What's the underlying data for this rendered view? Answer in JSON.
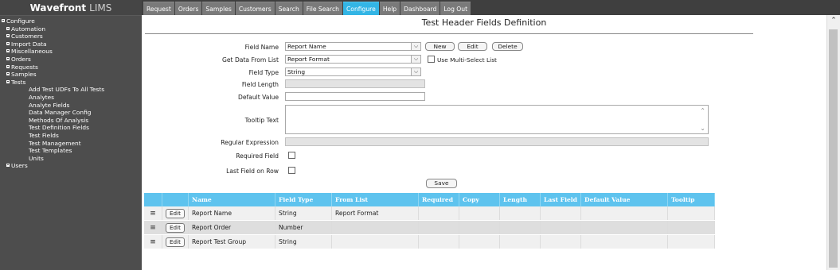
{
  "app": {
    "brand_name": "Wavefront",
    "brand_suffix": "LIMS"
  },
  "nav": {
    "tabs": [
      {
        "label": "Request"
      },
      {
        "label": "Orders"
      },
      {
        "label": "Samples"
      },
      {
        "label": "Customers"
      },
      {
        "label": "Search"
      },
      {
        "label": "File Search"
      },
      {
        "label": "Configure",
        "active": true
      },
      {
        "label": "Help"
      },
      {
        "label": "Dashboard"
      },
      {
        "label": "Log Out"
      }
    ]
  },
  "sidebar": {
    "root": "Configure",
    "items": [
      {
        "label": "Automation"
      },
      {
        "label": "Customers"
      },
      {
        "label": "Import Data"
      },
      {
        "label": "Miscellaneous"
      },
      {
        "label": "Orders"
      },
      {
        "label": "Requests"
      },
      {
        "label": "Samples"
      },
      {
        "label": "Tests"
      }
    ],
    "tests_children": [
      {
        "label": "Add Test UDFs To All Tests"
      },
      {
        "label": "Analytes"
      },
      {
        "label": "Analyte Fields"
      },
      {
        "label": "Data Manager Config"
      },
      {
        "label": "Methods Of Analysis"
      },
      {
        "label": "Test Definition Fields"
      },
      {
        "label": "Test Fields"
      },
      {
        "label": "Test Management"
      },
      {
        "label": "Test Templates"
      },
      {
        "label": "Units"
      }
    ],
    "last": "Users"
  },
  "page": {
    "title": "Test Header Fields Definition"
  },
  "form": {
    "field_name_label": "Field Name",
    "field_name_value": "Report Name",
    "new_label": "New",
    "edit_label": "Edit",
    "delete_label": "Delete",
    "get_data_label": "Get Data From List",
    "get_data_value": "Report Format",
    "multi_select_label": "Use Multi-Select List",
    "field_type_label": "Field Type",
    "field_type_value": "String",
    "field_length_label": "Field Length",
    "default_value_label": "Default Value",
    "tooltip_text_label": "Tooltip Text",
    "regex_label": "Regular Expression",
    "required_label": "Required Field",
    "last_field_label": "Last Field on Row",
    "save_label": "Save"
  },
  "grid": {
    "columns": [
      "Name",
      "Field Type",
      "From List",
      "Required",
      "Copy",
      "Length",
      "Last Field",
      "Default Value",
      "Tooltip"
    ],
    "edit_label": "Edit",
    "rows": [
      {
        "name": "Report Name",
        "type": "String",
        "from_list": "Report Format"
      },
      {
        "name": "Report Order",
        "type": "Number",
        "from_list": ""
      },
      {
        "name": "Report Test Group",
        "type": "String",
        "from_list": ""
      }
    ]
  },
  "colors": {
    "accent": "#33b5e5",
    "header": "#5ec3ee",
    "sidebar": "#4d4d4d"
  }
}
